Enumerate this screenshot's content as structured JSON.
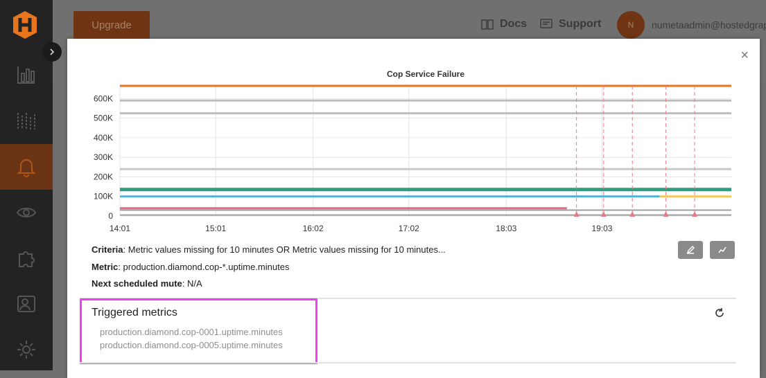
{
  "header": {
    "upgrade_label": "Upgrade",
    "docs_label": "Docs",
    "support_label": "Support",
    "avatar_initial": "N",
    "user_email": "numetaadmin@hostedgraph"
  },
  "sidebar": {
    "items": [
      {
        "icon": "bar-chart-icon",
        "active": false
      },
      {
        "icon": "dashboard-icon",
        "active": false
      },
      {
        "icon": "bell-icon",
        "active": true
      },
      {
        "icon": "eye-icon",
        "active": false
      },
      {
        "icon": "puzzle-icon",
        "active": false
      },
      {
        "icon": "users-icon",
        "active": false
      },
      {
        "icon": "gear-icon",
        "active": false
      }
    ]
  },
  "modal": {
    "close_label": "×",
    "criteria_label": "Criteria",
    "criteria_value": "Metric values missing for 10 minutes OR Metric values missing for 10 minutes...",
    "metric_label": "Metric",
    "metric_value": "production.diamond.cop-*.uptime.minutes",
    "mute_label": "Next scheduled mute",
    "mute_value": "N/A",
    "triggered_title": "Triggered metrics",
    "triggered_metrics": [
      "production.diamond.cop-0001.uptime.minutes",
      "production.diamond.cop-0005.uptime.minutes"
    ]
  },
  "colors": {
    "accent": "#e8741e",
    "active_sidebar": "#6b3414"
  },
  "chart_data": {
    "type": "line",
    "title": "Cop Service Failure",
    "xlabel": "",
    "ylabel": "",
    "x_ticks": [
      "14:01",
      "15:01",
      "16:02",
      "17:02",
      "18:03",
      "19:03"
    ],
    "x_tick_minutes": [
      0,
      60,
      121,
      181,
      242,
      302
    ],
    "xlim_minutes": [
      0,
      383
    ],
    "y_ticks": [
      "0",
      "100K",
      "200K",
      "300K",
      "400K",
      "500K",
      "600K"
    ],
    "y_tick_values": [
      0,
      100000,
      200000,
      300000,
      400000,
      500000,
      600000
    ],
    "ylim": [
      0,
      665000
    ],
    "grid": true,
    "legend": "none",
    "series": [
      {
        "color": "#e8741e",
        "width": 3,
        "points": [
          [
            0,
            665000
          ],
          [
            383,
            665000
          ]
        ]
      },
      {
        "color": "#bdbdbd",
        "width": 3,
        "points": [
          [
            0,
            590000
          ],
          [
            383,
            590000
          ]
        ]
      },
      {
        "color": "#bdbdbd",
        "width": 3,
        "points": [
          [
            0,
            525000
          ],
          [
            383,
            525000
          ]
        ]
      },
      {
        "color": "#c9c9c9",
        "width": 3,
        "points": [
          [
            0,
            240000
          ],
          [
            383,
            240000
          ]
        ]
      },
      {
        "color": "#2e9e7e",
        "width": 5,
        "points": [
          [
            0,
            135000
          ],
          [
            383,
            135000
          ]
        ]
      },
      {
        "color": "#4fb0d8",
        "width": 3,
        "points": [
          [
            0,
            100000
          ],
          [
            338,
            100000
          ]
        ]
      },
      {
        "color": "#f2c85c",
        "width": 3,
        "points": [
          [
            338,
            100000
          ],
          [
            383,
            100000
          ]
        ]
      },
      {
        "color": "#e56b8a",
        "width": 3,
        "points": [
          [
            0,
            40000
          ],
          [
            280,
            40000
          ]
        ]
      },
      {
        "color": "#9e9e9e",
        "width": 2,
        "points": [
          [
            0,
            30000
          ],
          [
            383,
            30000
          ]
        ]
      },
      {
        "color": "#9e9e9e",
        "width": 2,
        "points": [
          [
            0,
            5000
          ],
          [
            383,
            5000
          ]
        ]
      }
    ],
    "events_minutes": [
      286,
      303,
      321,
      342,
      360
    ],
    "event_color": "#e8798a"
  }
}
